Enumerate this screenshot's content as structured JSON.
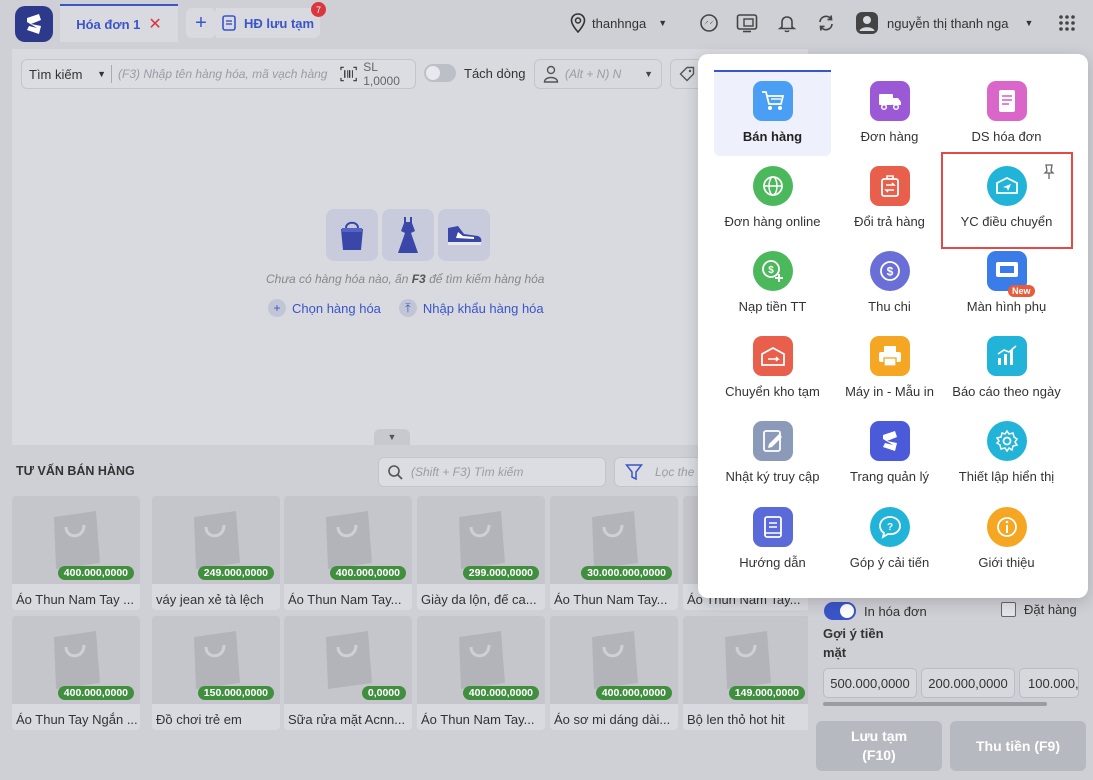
{
  "header": {
    "tab_active_label": "Hóa đơn 1",
    "tab_close": "✕",
    "tab_add": "+",
    "tab_saved_label": "HĐ lưu tạm",
    "tab_saved_count": "7",
    "branch": "thanhnga",
    "user_name": "nguyễn thị thanh nga"
  },
  "search": {
    "mode": "Tìm kiếm",
    "placeholder": "(F3) Nhập tên hàng hóa, mã vạch hàng",
    "qty": "SL 1,0000",
    "split_line": "Tách dòng",
    "customer_placeholder": "(Alt + N) N"
  },
  "empty_state": {
    "message_prefix": "Chưa có hàng hóa nào, ấn ",
    "message_key": "F3",
    "message_suffix": " để tìm kiếm hàng hóa",
    "choose_label": "Chọn hàng hóa",
    "import_label": "Nhập khẩu hàng hóa"
  },
  "advisory": {
    "title": "TƯ VẤN BÁN HÀNG",
    "search_placeholder": "(Shift + F3) Tìm kiếm",
    "filter_placeholder": "Lọc the"
  },
  "products": [
    {
      "name": "Áo Thun Nam Tay ...",
      "price": "400.000,0000"
    },
    {
      "name": "váy jean xẻ tà lệch",
      "price": "249.000,0000"
    },
    {
      "name": "Áo Thun Nam Tay...",
      "price": "400.000,0000"
    },
    {
      "name": "Giày da lộn, đế ca...",
      "price": "299.000,0000"
    },
    {
      "name": "Áo Thun Nam Tay...",
      "price": "30.000.000,0000"
    },
    {
      "name": "Áo Thun Nam Tay...",
      "price": ""
    },
    {
      "name": "Áo Thun Tay Ngắn ...",
      "price": "400.000,0000"
    },
    {
      "name": "Đồ chơi trẻ em",
      "price": "150.000,0000"
    },
    {
      "name": "Sữa rửa mặt Acnn...",
      "price": "0,0000"
    },
    {
      "name": "Áo Thun Nam Tay...",
      "price": "400.000,0000"
    },
    {
      "name": "Áo sơ mi dáng dài...",
      "price": "400.000,0000"
    },
    {
      "name": "Bộ len thỏ hot hit",
      "price": "149.000,0000"
    }
  ],
  "payment": {
    "print_invoice": "In hóa đơn",
    "order": "Đặt hàng",
    "cash_suggest": "Gợi ý tiền mặt",
    "cash_options": [
      "500.000,0000",
      "200.000,0000",
      "100.000,"
    ],
    "save_label": "Lưu tạm",
    "save_key": "(F10)",
    "pay_label": "Thu tiền (F9)"
  },
  "menu": {
    "items": [
      {
        "label": "Bán hàng",
        "icon": "cart-icon",
        "color": "#4a9ff5"
      },
      {
        "label": "Đơn hàng",
        "icon": "truck-icon",
        "color": "#9b59d6"
      },
      {
        "label": "DS hóa đơn",
        "icon": "invoice-list-icon",
        "color": "#d966c8"
      },
      {
        "label": "Đơn hàng online",
        "icon": "globe-icon",
        "color": "#4cb85c"
      },
      {
        "label": "Đổi trả hàng",
        "icon": "return-icon",
        "color": "#e8604c"
      },
      {
        "label": "YC điều chuyển",
        "icon": "transfer-icon",
        "color": "#22b4d8"
      },
      {
        "label": "Nạp tiền TT",
        "icon": "topup-icon",
        "color": "#4cb85c"
      },
      {
        "label": "Thu chi",
        "icon": "dollar-icon",
        "color": "#6a6fd8"
      },
      {
        "label": "Màn hình phụ",
        "icon": "monitor-icon",
        "color": "#3a7de8",
        "badge": "New"
      },
      {
        "label": "Chuyển kho tạm",
        "icon": "warehouse-icon",
        "color": "#e8604c"
      },
      {
        "label": "Máy in - Mẫu in",
        "icon": "printer-icon",
        "color": "#f5a623"
      },
      {
        "label": "Báo cáo theo ngày",
        "icon": "report-icon",
        "color": "#22b4d8"
      },
      {
        "label": "Nhật ký truy cập",
        "icon": "log-icon",
        "color": "#8a9ab8"
      },
      {
        "label": "Trang quản lý",
        "icon": "admin-icon",
        "color": "#4a5ad8"
      },
      {
        "label": "Thiết lập hiển thị",
        "icon": "settings-icon",
        "color": "#22b4d8"
      },
      {
        "label": "Hướng dẫn",
        "icon": "book-icon",
        "color": "#5a6ad8"
      },
      {
        "label": "Góp ý cải tiến",
        "icon": "feedback-icon",
        "color": "#22b4d8"
      },
      {
        "label": "Giới thiệu",
        "icon": "info-icon",
        "color": "#f5a623"
      }
    ]
  }
}
